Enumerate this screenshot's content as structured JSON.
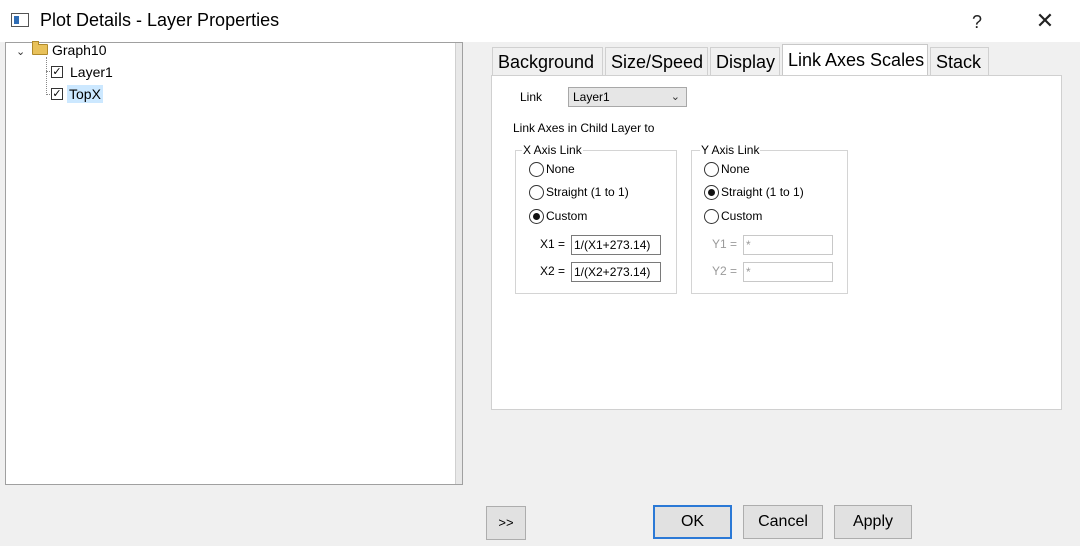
{
  "window": {
    "title": "Plot Details - Layer Properties",
    "help_glyph": "?",
    "close_glyph": "✕"
  },
  "tree": {
    "root": {
      "label": "Graph10",
      "expanded": true,
      "expander_glyph": "⌄"
    },
    "children": [
      {
        "label": "Layer1",
        "checked": true,
        "selected": false
      },
      {
        "label": "TopX",
        "checked": true,
        "selected": true
      }
    ],
    "check_glyph": "✓"
  },
  "tabs": [
    {
      "label": "Background"
    },
    {
      "label": "Size/Speed"
    },
    {
      "label": "Display"
    },
    {
      "label": "Link Axes Scales",
      "active": true
    },
    {
      "label": "Stack"
    }
  ],
  "link": {
    "label": "Link",
    "selected": "Layer1",
    "chevron_glyph": "⌄"
  },
  "child_layer_label": "Link Axes in Child Layer to",
  "x_axis_link": {
    "title": "X Axis Link",
    "options": [
      "None",
      "Straight (1 to 1)",
      "Custom"
    ],
    "selected": "Custom",
    "x1_label": "X1 =",
    "x1_value": "1/(X1+273.14)",
    "x2_label": "X2 =",
    "x2_value": "1/(X2+273.14)"
  },
  "y_axis_link": {
    "title": "Y Axis Link",
    "options": [
      "None",
      "Straight (1 to 1)",
      "Custom"
    ],
    "selected": "Straight (1 to 1)",
    "y1_label": "Y1 =",
    "y1_value": "*",
    "y2_label": "Y2 =",
    "y2_value": "*"
  },
  "buttons": {
    "expand": ">>",
    "ok": "OK",
    "cancel": "Cancel",
    "apply": "Apply"
  },
  "colors": {
    "accent": "#2b79d6",
    "selection": "#cce8ff"
  }
}
